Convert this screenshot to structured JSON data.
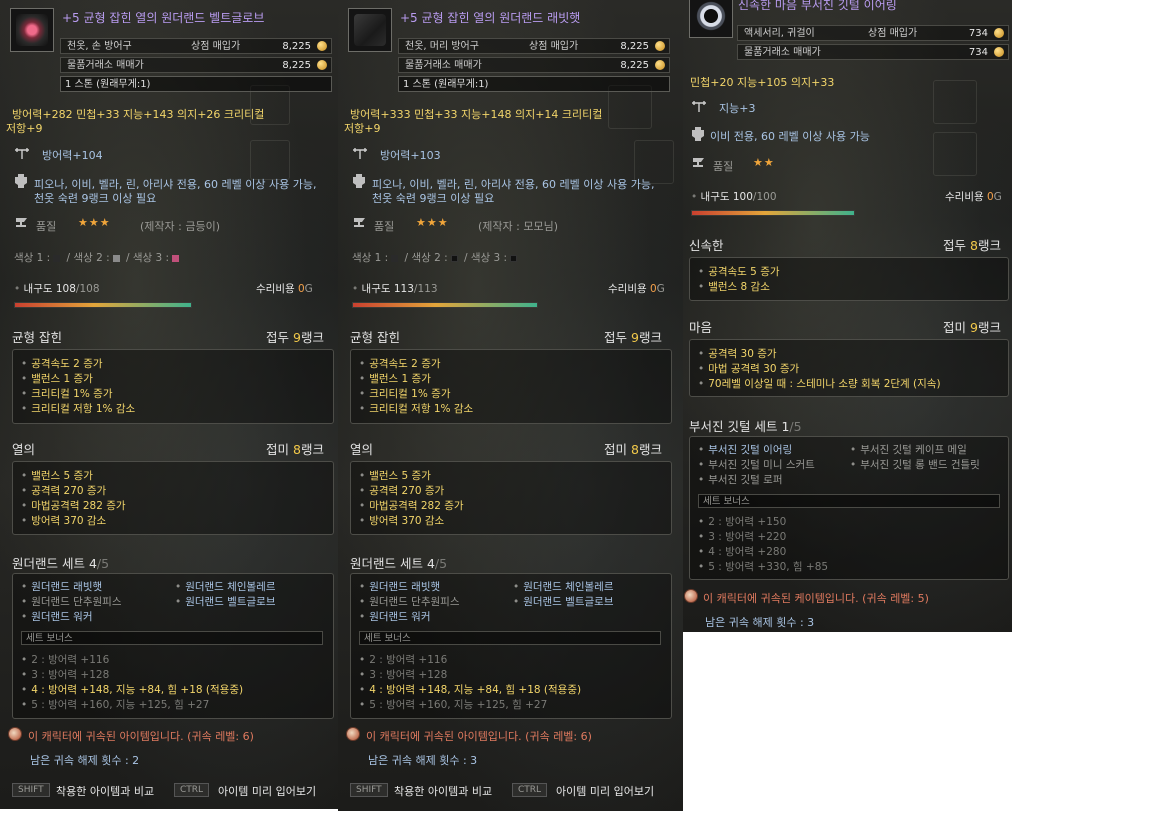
{
  "tooltips": [
    {
      "title": "+5 균형 잡힌 열의 원더랜드 벨트글로브",
      "category": "천옷, 손 방어구",
      "shop_label": "상점 매입가",
      "shop_price": "8,225",
      "market_label": "물품거래소 매매가",
      "market_price": "8,225",
      "weight": "1 스톤 (원래무게:1)",
      "stats_line1": "방어력+282   민첩+33   지능+143   의지+26   크리티컬",
      "stats_line2": "저항+9",
      "defense": "방어력+104",
      "req_line1": "피오나, 이비, 벨라, 린, 아리샤 전용, 60 레벨 이상 사용 가능,",
      "req_line2": "천옷 숙련 9랭크 이상 필요",
      "quality_label": "품질",
      "quality_stars": "★★★",
      "maker": "(제작자 : 금등이)",
      "color_labels": [
        "색상 1 :",
        "색상 2 :",
        "색상 3 :"
      ],
      "color_values": [
        "#2a2a2a",
        "#8a8a8a",
        "#c0507a"
      ],
      "durability_label": "내구도",
      "durability_current": "108",
      "durability_max": "/108",
      "durability_pct": 100,
      "repair_label": "수리비용",
      "repair_cost": "0",
      "repair_unit": "G",
      "enchants": [
        {
          "name": "균형 잡힌",
          "rank_prefix": "접두",
          "rank_num": "9",
          "rank_suffix": "랭크",
          "effects": [
            "공격속도 2 증가",
            "밸런스 1 증가",
            "크리티컬 1% 증가",
            "크리티컬 저항 1% 감소"
          ]
        },
        {
          "name": "열의",
          "rank_prefix": "접미",
          "rank_num": "8",
          "rank_suffix": "랭크",
          "effects": [
            "밸런스 5 증가",
            "공격력 270 증가",
            "마법공격력 282 증가",
            "방어력 370 감소"
          ]
        }
      ],
      "set_name": "원더랜드 세트",
      "set_count": "4",
      "set_total": "/5",
      "set_items": [
        "원더랜드 래빗햇",
        "원더랜드 체인볼레르",
        "원더랜드 단추원피스",
        "원더랜드 벨트글로브",
        "원더랜드 워커"
      ],
      "set_items_active": [
        true,
        true,
        false,
        true,
        true
      ],
      "set_bonus_label": "세트 보너스",
      "set_bonuses": [
        "2 : 방어력 +116",
        "3 : 방어력 +128",
        "4 : 방어력 +148, 지능 +84, 힘 +18 (적용중)",
        "5 : 방어력 +160, 지능 +125, 힘 +27"
      ],
      "set_bonus_active": [
        false,
        false,
        true,
        false
      ],
      "bind_text": "이 캐릭터에 귀속된 아이템입니다. (귀속 레벨: 6)",
      "unbind_text": "남은 귀속 해제 횟수 : 2",
      "shift_key": "SHIFT",
      "shift_text": "착용한 아이템과 비교",
      "ctrl_key": "CTRL",
      "ctrl_text": "아이템 미리 입어보기"
    },
    {
      "title": "+5 균형 잡힌 열의 원더랜드 래빗햇",
      "category": "천옷, 머리 방어구",
      "shop_label": "상점 매입가",
      "shop_price": "8,225",
      "market_label": "물품거래소 매매가",
      "market_price": "8,225",
      "weight": "1 스톤 (원래무게:1)",
      "stats_line1": "방어력+333   민첩+33   지능+148   의지+14   크리티컬",
      "stats_line2": "저항+9",
      "defense": "방어력+103",
      "req_line1": "피오나, 이비, 벨라, 린, 아리샤 전용, 60 레벨 이상 사용 가능,",
      "req_line2": "천옷 숙련 9랭크 이상 필요",
      "quality_label": "품질",
      "quality_stars": "★★★",
      "maker": "(제작자 : 모모님)",
      "color_labels": [
        "색상 1 :",
        "색상 2 :",
        "색상 3 :"
      ],
      "color_values": [
        "#2a2a2a",
        "#111111",
        "#111111"
      ],
      "durability_label": "내구도",
      "durability_current": "113",
      "durability_max": "/113",
      "durability_pct": 100,
      "repair_label": "수리비용",
      "repair_cost": "0",
      "repair_unit": "G",
      "enchants": [
        {
          "name": "균형 잡힌",
          "rank_prefix": "접두",
          "rank_num": "9",
          "rank_suffix": "랭크",
          "effects": [
            "공격속도 2 증가",
            "밸런스 1 증가",
            "크리티컬 1% 증가",
            "크리티컬 저항 1% 감소"
          ]
        },
        {
          "name": "열의",
          "rank_prefix": "접미",
          "rank_num": "8",
          "rank_suffix": "랭크",
          "effects": [
            "밸런스 5 증가",
            "공격력 270 증가",
            "마법공격력 282 증가",
            "방어력 370 감소"
          ]
        }
      ],
      "set_name": "원더랜드 세트",
      "set_count": "4",
      "set_total": "/5",
      "set_items": [
        "원더랜드 래빗햇",
        "원더랜드 체인볼레르",
        "원더랜드 단추원피스",
        "원더랜드 벨트글로브",
        "원더랜드 워커"
      ],
      "set_items_active": [
        true,
        true,
        false,
        true,
        true
      ],
      "set_bonus_label": "세트 보너스",
      "set_bonuses": [
        "2 : 방어력 +116",
        "3 : 방어력 +128",
        "4 : 방어력 +148, 지능 +84, 힘 +18 (적용중)",
        "5 : 방어력 +160, 지능 +125, 힘 +27"
      ],
      "set_bonus_active": [
        false,
        false,
        true,
        false
      ],
      "bind_text": "이 캐릭터에 귀속된 아이템입니다. (귀속 레벨: 6)",
      "unbind_text": "남은 귀속 해제 횟수 : 3",
      "shift_key": "SHIFT",
      "shift_text": "착용한 아이템과 비교",
      "ctrl_key": "CTRL",
      "ctrl_text": "아이템 미리 입어보기"
    },
    {
      "title": "신속한 마음 부서진 깃털 이어링",
      "category": "액세서리, 귀걸이",
      "shop_label": "상점 매입가",
      "shop_price": "734",
      "market_label": "물품거래소 매매가",
      "market_price": "734",
      "stats_line1": "민첩+20   지능+105   의지+33",
      "defense": "지능+3",
      "req_line1": "이비 전용, 60 레벨 이상 사용 가능",
      "quality_label": "품질",
      "quality_stars": "★★",
      "durability_label": "내구도",
      "durability_current": "100",
      "durability_max": "/100",
      "durability_pct": 100,
      "repair_label": "수리비용",
      "repair_cost": "0",
      "repair_unit": "G",
      "enchants": [
        {
          "name": "신속한",
          "rank_prefix": "접두",
          "rank_num": "8",
          "rank_suffix": "랭크",
          "effects": [
            "공격속도 5 증가",
            "밸런스 8 감소"
          ]
        },
        {
          "name": "마음",
          "rank_prefix": "접미",
          "rank_num": "9",
          "rank_suffix": "랭크",
          "effects": [
            "공격력 30 증가",
            "마법 공격력 30 증가",
            "70레벨 이상일 때 : 스테미나 소량 회복 2단계 (지속)"
          ]
        }
      ],
      "set_name": "부서진 깃털 세트",
      "set_count": "1",
      "set_total": "/5",
      "set_items": [
        "부서진 깃털 이어링",
        "부서진 깃털 케이프 메일",
        "부서진 깃털 미니 스커트",
        "부서진 깃털 롱 밴드 건틀릿",
        "부서진 깃털 로퍼"
      ],
      "set_items_active": [
        true,
        false,
        false,
        false,
        false
      ],
      "set_bonus_label": "세트 보너스",
      "set_bonuses": [
        "2 : 방어력 +150",
        "3 : 방어력 +220",
        "4 : 방어력 +280",
        "5 : 방어력 +330, 힘 +85"
      ],
      "set_bonus_active": [
        false,
        false,
        false,
        false
      ],
      "bind_text": "이 캐릭터에 귀속된 케이템입니다. (귀속 레벨: 5)",
      "unbind_text": "남은 귀속 해제 횟수 : 3"
    }
  ],
  "colors": {
    "title": "#b99cf0",
    "stat_yellow": "#f2d56a",
    "rank_gold": "#f2c94a",
    "set_item_active": "#a9c4e4",
    "bind_red": "#e07a5f"
  },
  "icons": [
    "glove-icon",
    "hat-icon",
    "earring-icon",
    "gold-coin-icon",
    "craft-tool-icon",
    "armor-class-icon",
    "anvil-icon",
    "bind-warning-icon"
  ]
}
